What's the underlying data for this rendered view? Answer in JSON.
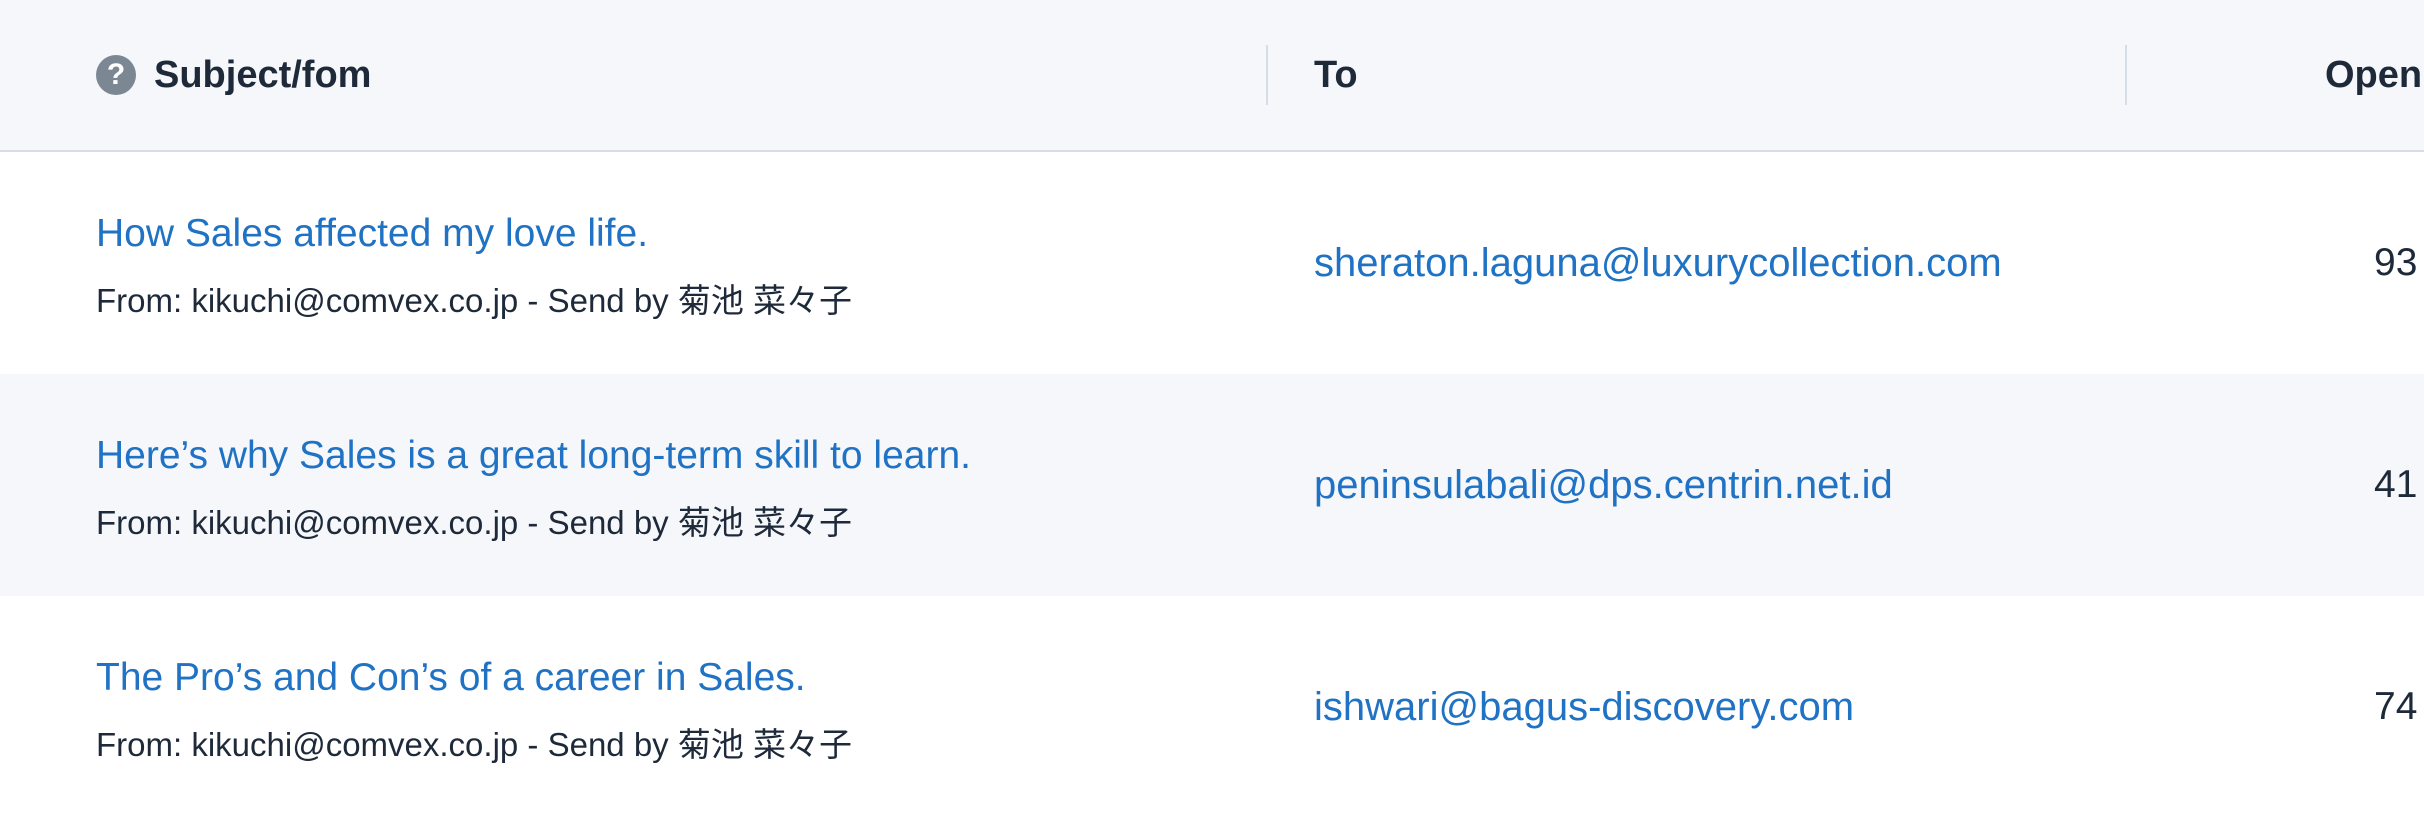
{
  "table": {
    "headers": {
      "subject": "Subject/fom",
      "to": "To",
      "open": "Open"
    },
    "rows": [
      {
        "subject": "How Sales affected my love life.",
        "from": "From: kikuchi@comvex.co.jp - Send by 菊池 菜々子",
        "to": "sheraton.laguna@luxurycollection.com",
        "open": "93"
      },
      {
        "subject": "Here’s why Sales is a great long-term skill to learn.",
        "from": "From: kikuchi@comvex.co.jp - Send by 菊池 菜々子",
        "to": "peninsulabali@dps.centrin.net.id",
        "open": "41"
      },
      {
        "subject": "The Pro’s and Con’s of a career in Sales.",
        "from": "From: kikuchi@comvex.co.jp - Send by 菊池 菜々子",
        "to": "ishwari@bagus-discovery.com",
        "open": "74"
      }
    ]
  },
  "icons": {
    "help": "help-circle-icon",
    "help_glyph": "?"
  },
  "colors": {
    "link": "#1f72c4",
    "text": "#1e2a3a",
    "header_bg": "#f5f7fa",
    "alt_row_bg": "#f5f7fa",
    "divider": "#d6dde6",
    "icon_bg": "#7c8794"
  }
}
